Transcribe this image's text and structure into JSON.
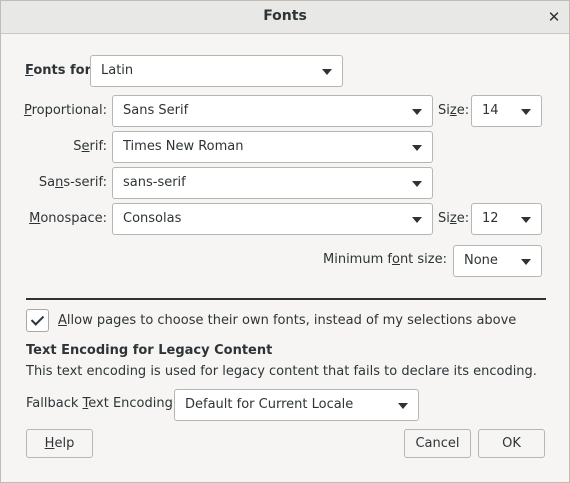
{
  "dialog": {
    "title": "Fonts",
    "close_glyph": "✕"
  },
  "fonts_for": {
    "label_u": "F",
    "label_rest": "onts for:",
    "value": "Latin"
  },
  "proportional": {
    "label_u": "P",
    "label_rest": "roportional:",
    "value": "Sans Serif",
    "size_label_pre": "Si",
    "size_label_u": "z",
    "size_label_post": "e:",
    "size_value": "14"
  },
  "serif": {
    "label_pre": "S",
    "label_u": "e",
    "label_post": "rif:",
    "value": "Times New Roman"
  },
  "sans_serif": {
    "label_pre": "Sa",
    "label_u": "n",
    "label_post": "s-serif:",
    "value": "sans-serif"
  },
  "monospace": {
    "label_u": "M",
    "label_rest": "onospace:",
    "value": "Consolas",
    "size_label_pre": "Si",
    "size_label_u": "z",
    "size_label_post": "e:",
    "size_value": "12"
  },
  "minimum_font_size": {
    "label_pre": "Minimum f",
    "label_u": "o",
    "label_post": "nt size:",
    "value": "None"
  },
  "allow_pages": {
    "label_u": "A",
    "label_rest": "llow pages to choose their own fonts, instead of my selections above",
    "checked": true
  },
  "text_encoding": {
    "heading": "Text Encoding for Legacy Content",
    "description": "This text encoding is used for legacy content that fails to declare its encoding.",
    "fallback_label_pre": "Fallback ",
    "fallback_label_u": "T",
    "fallback_label_post": "ext Encoding:",
    "fallback_value": "Default for Current Locale"
  },
  "buttons": {
    "help_u": "H",
    "help_rest": "elp",
    "cancel": "Cancel",
    "ok": "OK"
  }
}
